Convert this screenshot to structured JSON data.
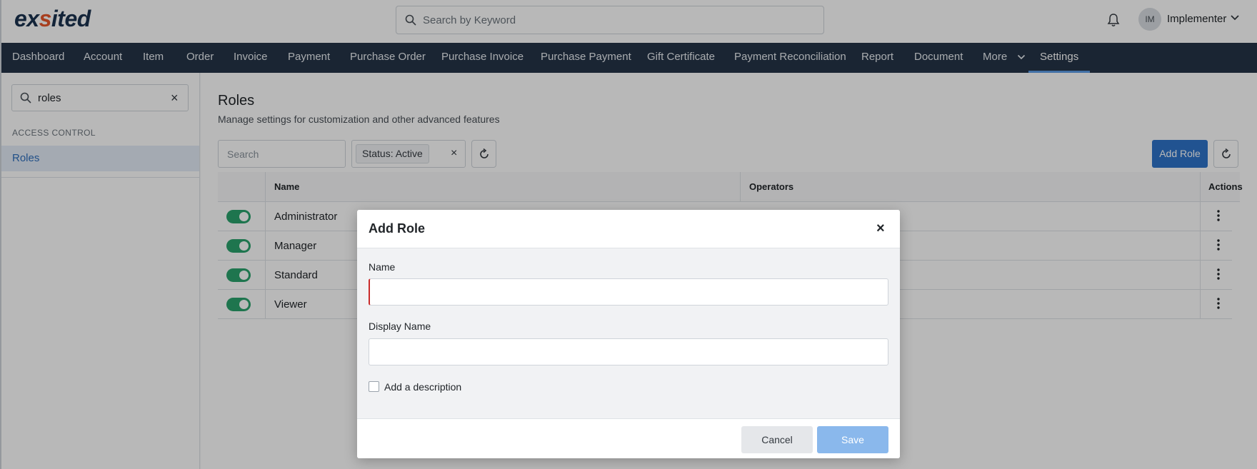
{
  "brand": {
    "logo_text_a": "ex",
    "logo_text_b": "s",
    "logo_text_c": "ited"
  },
  "header": {
    "search_placeholder": "Search by Keyword",
    "user_initials": "IM",
    "user_name": "Implementer"
  },
  "nav": {
    "items": [
      {
        "label": "Dashboard"
      },
      {
        "label": "Account"
      },
      {
        "label": "Item"
      },
      {
        "label": "Order"
      },
      {
        "label": "Invoice"
      },
      {
        "label": "Payment"
      },
      {
        "label": "Purchase Order"
      },
      {
        "label": "Purchase Invoice"
      },
      {
        "label": "Purchase Payment"
      },
      {
        "label": "Gift Certificate"
      },
      {
        "label": "Payment Reconciliation"
      },
      {
        "label": "Report"
      },
      {
        "label": "Document"
      },
      {
        "label": "More"
      },
      {
        "label": "Settings"
      }
    ],
    "active": "Settings"
  },
  "sidebar": {
    "search_value": "roles",
    "section_title": "ACCESS CONTROL",
    "items": [
      {
        "label": "Roles",
        "selected": true
      }
    ]
  },
  "main": {
    "title": "Roles",
    "subtitle": "Manage settings for customization and other advanced features",
    "search_placeholder": "Search",
    "filter_chip": "Status: Active",
    "add_button": "Add Role",
    "columns": {
      "name": "Name",
      "operators": "Operators",
      "actions": "Actions"
    },
    "rows": [
      {
        "name": "Administrator",
        "active": true
      },
      {
        "name": "Manager",
        "active": true
      },
      {
        "name": "Standard",
        "active": true
      },
      {
        "name": "Viewer",
        "active": true
      }
    ]
  },
  "modal": {
    "title": "Add Role",
    "close_glyph": "×",
    "name_label": "Name",
    "name_value": "",
    "display_name_label": "Display Name",
    "display_name_value": "",
    "description_checkbox_label": "Add a description",
    "description_checked": false,
    "cancel_label": "Cancel",
    "save_label": "Save"
  },
  "colors": {
    "nav_bg": "#243447",
    "primary": "#2f74c9",
    "toggle_on": "#2aa36d",
    "invalid": "#c92a2a"
  },
  "icons": [
    "search-icon",
    "bell-icon",
    "chevron-down-icon",
    "close-icon",
    "refresh-icon",
    "kebab-icon"
  ]
}
